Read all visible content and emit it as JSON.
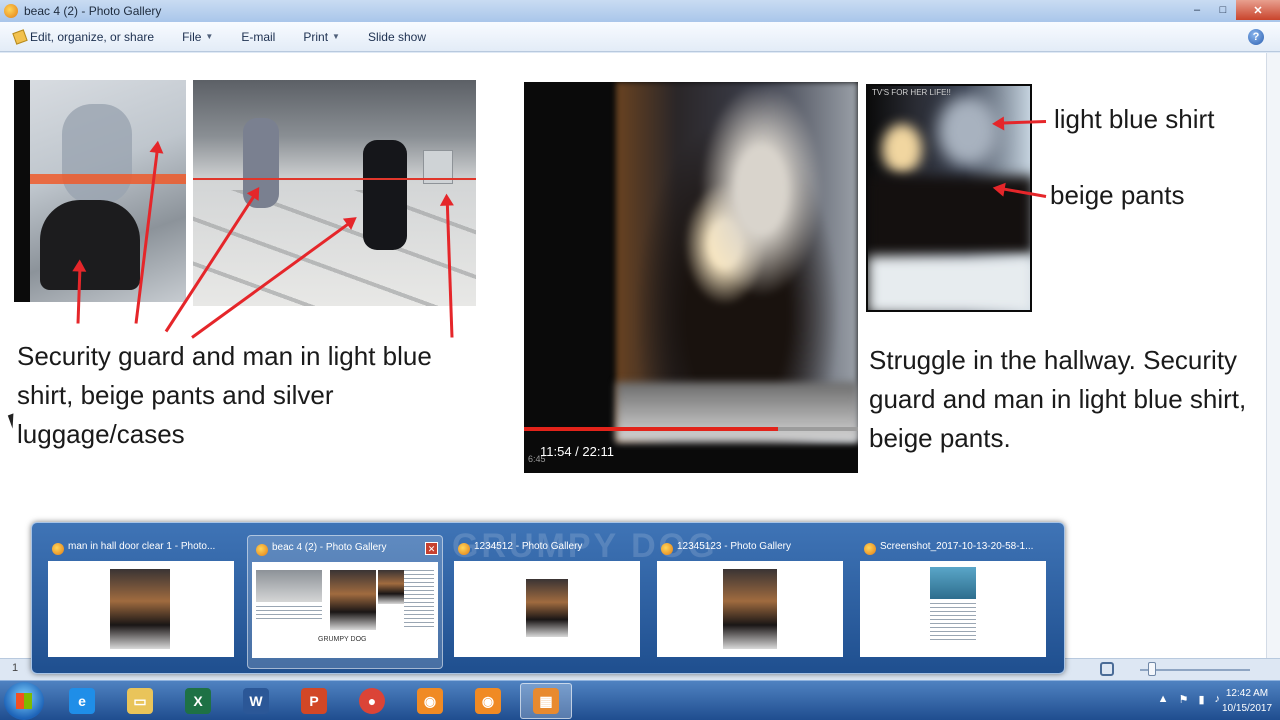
{
  "window": {
    "title": "beac 4 (2) - Photo Gallery",
    "controls": {
      "minimize": "–",
      "maximize": "□",
      "close": "✕"
    }
  },
  "menubar": {
    "items": [
      {
        "label": "Edit, organize, or share",
        "icon": "pencil-icon"
      },
      {
        "label": "File",
        "has_caret": true
      },
      {
        "label": "E-mail"
      },
      {
        "label": "Print",
        "has_caret": true
      },
      {
        "label": "Slide show"
      }
    ],
    "help_icon": "?"
  },
  "photo": {
    "caption_left": "Security guard and man in light blue shirt, beige pants and silver luggage/cases",
    "caption_right": "Struggle in the hallway. Security guard and man in light blue shirt, beige pants.",
    "label_shirt": "light blue shirt",
    "label_pants": "beige pants",
    "video_time": "11:54 / 22:11",
    "video_small_time": "6:45",
    "video_progress": 0.76,
    "crop_caption": "TV'S FOR HER LIFE!!",
    "arrow_color": "#e5262a"
  },
  "thumbnails": {
    "watermark": "GRUMPY DOG",
    "items": [
      {
        "title": "man in hall door clear 1 - Photo...",
        "active": false
      },
      {
        "title": "beac 4 (2) - Photo Gallery",
        "active": true,
        "preview_caption": "GRUMPY DOG"
      },
      {
        "title": "1234512 - Photo Gallery",
        "active": false
      },
      {
        "title": "12345123 - Photo Gallery",
        "active": false
      },
      {
        "title": "Screenshot_2017-10-13-20-58-1...",
        "active": false
      }
    ],
    "close_label": "✕"
  },
  "statusbar": {
    "count": "1"
  },
  "taskbar": {
    "apps": [
      {
        "name": "internet-explorer",
        "glyph": "e",
        "color": "#1f8ee8"
      },
      {
        "name": "file-explorer",
        "glyph": "▭",
        "color": "#e9c45a"
      },
      {
        "name": "excel",
        "glyph": "X",
        "color": "#1e7145"
      },
      {
        "name": "word",
        "glyph": "W",
        "color": "#2b5797"
      },
      {
        "name": "powerpoint",
        "glyph": "P",
        "color": "#d24726"
      },
      {
        "name": "chrome",
        "glyph": "●",
        "color": "#34a853"
      },
      {
        "name": "app-orange-1",
        "glyph": "◉",
        "color": "#f08a24"
      },
      {
        "name": "app-orange-2",
        "glyph": "◉",
        "color": "#f08a24"
      },
      {
        "name": "photo-gallery",
        "glyph": "▦",
        "color": "#e88a2f"
      }
    ],
    "tray_icons": [
      "▲",
      "⚑",
      "▮",
      "♪"
    ],
    "clock_time": "12:42 AM",
    "clock_date": "10/15/2017"
  }
}
